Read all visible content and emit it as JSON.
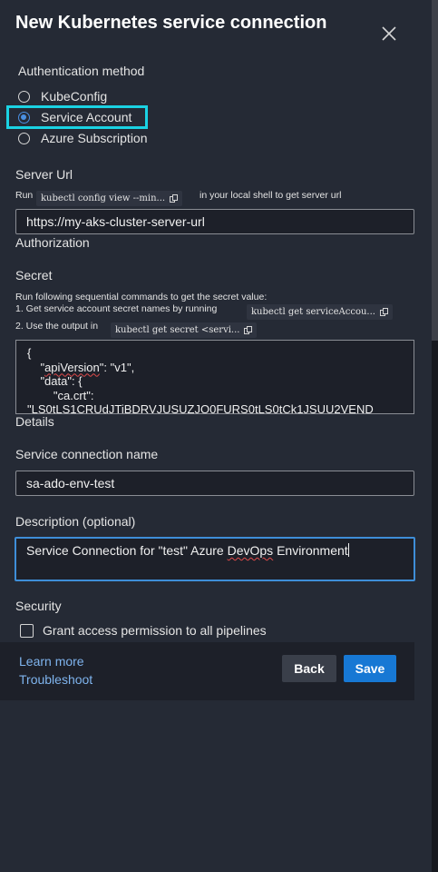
{
  "dialog": {
    "title": "New Kubernetes service connection"
  },
  "auth": {
    "heading": "Authentication method",
    "options": [
      "KubeConfig",
      "Service Account",
      "Azure Subscription"
    ],
    "selected": "Service Account"
  },
  "server": {
    "heading": "Server Url",
    "hint_prefix": "Run",
    "hint_command": "kubectl config view --min...",
    "hint_suffix": "in your local shell to get server url",
    "value": "https://my-aks-cluster-server-url"
  },
  "authorization": {
    "heading": "Authorization"
  },
  "secret": {
    "heading": "Secret",
    "instructions": "Run following sequential commands to get the secret value:",
    "step1_text": "1. Get service account secret names by running",
    "step1_command": "kubectl get serviceAccou...",
    "step2_text": "2. Use the output in",
    "step2_command": "kubectl get secret <servi...",
    "lines": [
      "{",
      "    \"apiVersion\": \"v1\",",
      "    \"data\": {",
      "        \"ca.crt\":",
      "\"LS0tLS1CRUdJTiBDRVJUSUZJQ0FURS0tLS0tCk1JSUU2VEND"
    ]
  },
  "details": {
    "heading": "Details",
    "connection_name_label": "Service connection name",
    "connection_name_value": "sa-ado-env-test",
    "description_label": "Description (optional)",
    "description_value": "Service Connection for \"test\" Azure DevOps Environment"
  },
  "security": {
    "heading": "Security",
    "grant_label": "Grant access permission to all pipelines",
    "grant_checked": false
  },
  "footer": {
    "learn_more": "Learn more",
    "troubleshoot": "Troubleshoot",
    "back": "Back",
    "save": "Save"
  },
  "colors": {
    "accent": "#1778d4",
    "highlight": "#1ad2e3",
    "link": "#7fb4ee"
  }
}
